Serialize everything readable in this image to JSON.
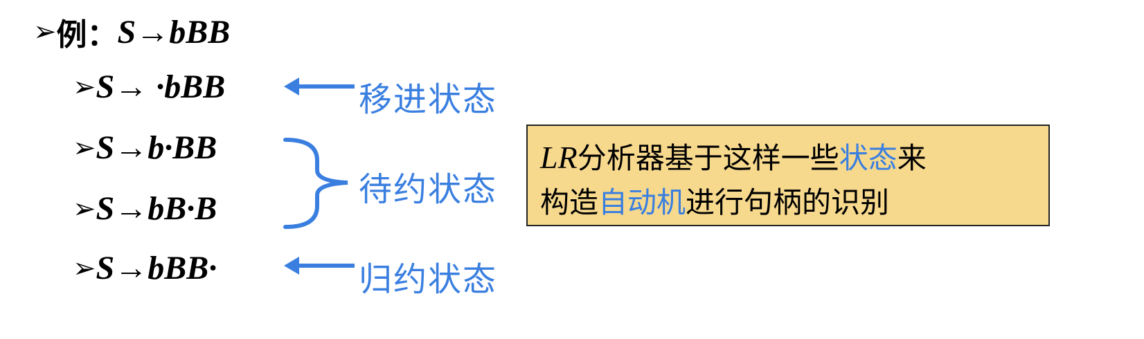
{
  "example": {
    "bullet": "➢",
    "prefix": "例：",
    "production": "S→bBB"
  },
  "items": [
    {
      "bullet": "➢",
      "text": "S→ ·bBB",
      "state_label": "移进状态"
    },
    {
      "bullet": "➢",
      "text": "S→b·BB",
      "state_label": "待约状态"
    },
    {
      "bullet": "➢",
      "text": "S→bB·B",
      "state_label": "待约状态"
    },
    {
      "bullet": "➢",
      "text": "S→bBB·",
      "state_label": "归约状态"
    }
  ],
  "note": {
    "line1_a": "LR",
    "line1_b": "分析器基于这样一些",
    "line1_c": "状态",
    "line1_d": "来",
    "line2_a": "构造",
    "line2_b": "自动机",
    "line2_c": "进行句柄的识别"
  },
  "colors": {
    "accent": "#3a7fe0",
    "note_bg": "#f7d98e"
  }
}
